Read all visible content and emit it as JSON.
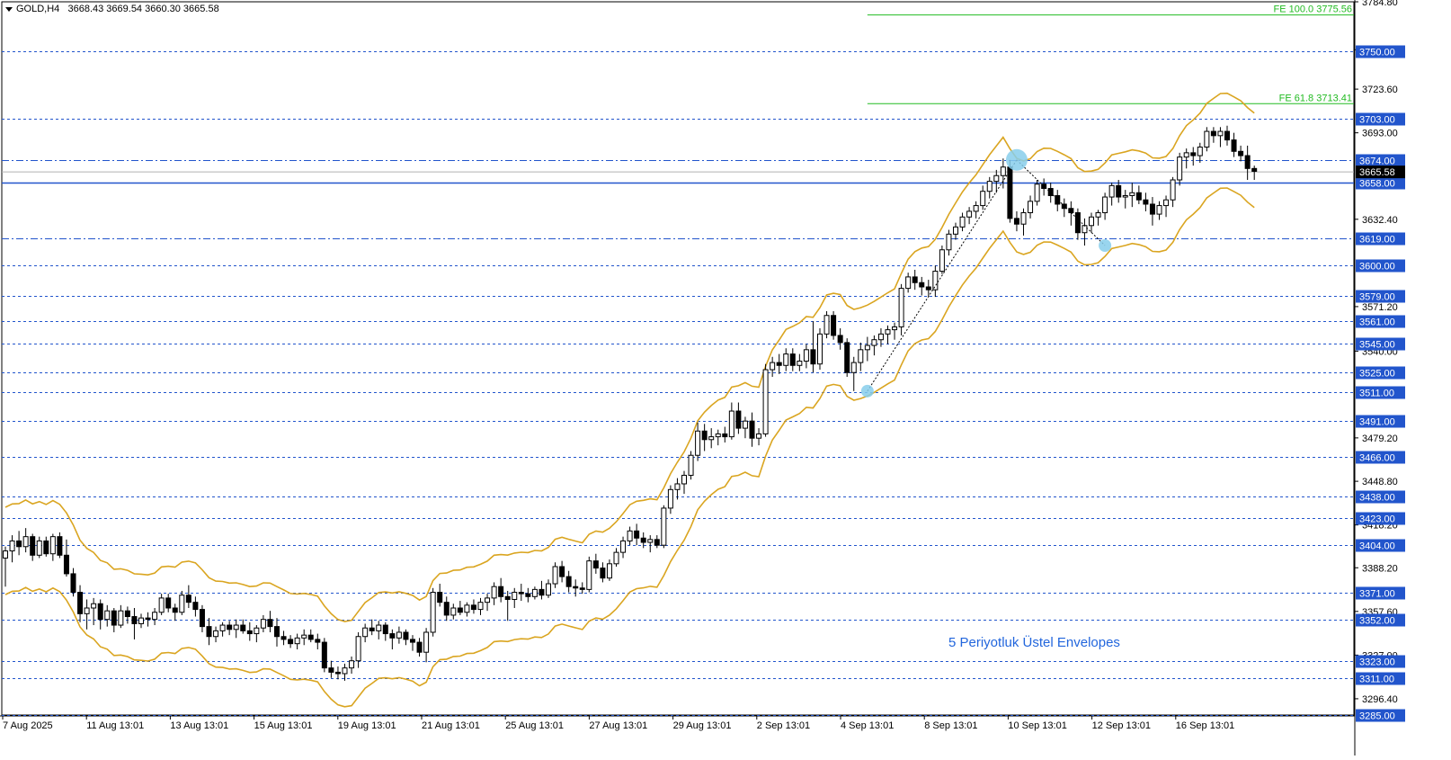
{
  "header": {
    "symbol": "GOLD,H4",
    "ohlc": "3668.43 3669.54 3660.30 3665.58"
  },
  "annotation": "5 Periyotluk Üstel Envelopes",
  "colors": {
    "up_candle": "#ffffff",
    "down_candle": "#000000",
    "envelope": "#daa520",
    "level_line": "#2255cc",
    "fib_line": "#22bb22",
    "label_bg": "#2255cc",
    "price_label_bg": "#000000",
    "marker": "#87ceeb"
  },
  "chart_data": {
    "type": "candlestick",
    "ylim": [
      3285,
      3784.8
    ],
    "current_price": "3665.58",
    "y_tick_labels": [
      "3784.80",
      "3751.20",
      "3723.60",
      "3693.00",
      "3632.40",
      "3571.20",
      "3540.00",
      "3479.20",
      "3448.80",
      "3418.20",
      "3388.20",
      "3357.60",
      "3327.00",
      "3296.40"
    ],
    "x_tick_labels": [
      "7 Aug 2025",
      "11 Aug 13:01",
      "13 Aug 13:01",
      "15 Aug 13:01",
      "19 Aug 13:01",
      "21 Aug 13:01",
      "25 Aug 13:01",
      "27 Aug 13:01",
      "29 Aug 13:01",
      "2 Sep 13:01",
      "4 Sep 13:01",
      "8 Sep 13:01",
      "10 Sep 13:01",
      "12 Sep 13:01",
      "16 Sep 13:01"
    ],
    "levels": [
      {
        "value": 3750.0,
        "label": "3750.00",
        "style": "dashed"
      },
      {
        "value": 3703.0,
        "label": "3703.00",
        "style": "dashed"
      },
      {
        "value": 3674.0,
        "label": "3674.00",
        "style": "dashdot"
      },
      {
        "value": 3658.0,
        "label": "3658.00",
        "style": "solid"
      },
      {
        "value": 3619.0,
        "label": "3619.00",
        "style": "dashdot"
      },
      {
        "value": 3600.0,
        "label": "3600.00",
        "style": "dashed"
      },
      {
        "value": 3579.0,
        "label": "3579.00",
        "style": "dashed"
      },
      {
        "value": 3561.0,
        "label": "3561.00",
        "style": "dashed"
      },
      {
        "value": 3545.0,
        "label": "3545.00",
        "style": "dashed"
      },
      {
        "value": 3525.0,
        "label": "3525.00",
        "style": "dashed"
      },
      {
        "value": 3511.0,
        "label": "3511.00",
        "style": "dashed"
      },
      {
        "value": 3491.0,
        "label": "3491.00",
        "style": "dashed"
      },
      {
        "value": 3466.0,
        "label": "3466.00",
        "style": "dashed"
      },
      {
        "value": 3438.0,
        "label": "3438.00",
        "style": "dashed"
      },
      {
        "value": 3423.0,
        "label": "3423.00",
        "style": "dashed"
      },
      {
        "value": 3404.0,
        "label": "3404.00",
        "style": "dashed"
      },
      {
        "value": 3371.0,
        "label": "3371.00",
        "style": "dashed"
      },
      {
        "value": 3352.0,
        "label": "3352.00",
        "style": "dashed"
      },
      {
        "value": 3323.0,
        "label": "3323.00",
        "style": "dashed"
      },
      {
        "value": 3311.0,
        "label": "3311.00",
        "style": "dashed"
      },
      {
        "value": 3285.0,
        "label": "3285.00",
        "style": "dashed"
      }
    ],
    "fib_lines": [
      {
        "value": 3775.56,
        "label": "FE 100.0 3775.56",
        "start_bar": 127
      },
      {
        "value": 3713.41,
        "label": "FE 61.8 3713.41",
        "start_bar": 127
      }
    ],
    "fib_points": [
      {
        "bar": 127,
        "price": 3512
      },
      {
        "bar": 149,
        "price": 3674
      },
      {
        "bar": 162,
        "price": 3614
      }
    ],
    "envelope_offset_pct": 0.9,
    "candles": [
      [
        3395,
        3403,
        3375,
        3400
      ],
      [
        3400,
        3411,
        3392,
        3407
      ],
      [
        3407,
        3414,
        3397,
        3403
      ],
      [
        3403,
        3416,
        3399,
        3410
      ],
      [
        3410,
        3412,
        3393,
        3397
      ],
      [
        3397,
        3410,
        3395,
        3407
      ],
      [
        3407,
        3410,
        3396,
        3398
      ],
      [
        3398,
        3412,
        3393,
        3410
      ],
      [
        3410,
        3413,
        3395,
        3397
      ],
      [
        3397,
        3408,
        3382,
        3384
      ],
      [
        3384,
        3388,
        3368,
        3371
      ],
      [
        3371,
        3376,
        3350,
        3356
      ],
      [
        3356,
        3366,
        3345,
        3360
      ],
      [
        3360,
        3367,
        3348,
        3363
      ],
      [
        3363,
        3366,
        3345,
        3352
      ],
      [
        3352,
        3362,
        3347,
        3358
      ],
      [
        3358,
        3360,
        3343,
        3348
      ],
      [
        3348,
        3362,
        3346,
        3358
      ],
      [
        3358,
        3361,
        3349,
        3354
      ],
      [
        3354,
        3360,
        3338,
        3349
      ],
      [
        3349,
        3356,
        3346,
        3353
      ],
      [
        3353,
        3357,
        3347,
        3352
      ],
      [
        3352,
        3360,
        3348,
        3357
      ],
      [
        3357,
        3370,
        3355,
        3367
      ],
      [
        3367,
        3370,
        3357,
        3360
      ],
      [
        3360,
        3363,
        3351,
        3357
      ],
      [
        3357,
        3372,
        3355,
        3369
      ],
      [
        3369,
        3376,
        3360,
        3364
      ],
      [
        3364,
        3368,
        3354,
        3359
      ],
      [
        3359,
        3362,
        3343,
        3347
      ],
      [
        3347,
        3353,
        3334,
        3340
      ],
      [
        3340,
        3347,
        3336,
        3344
      ],
      [
        3344,
        3350,
        3340,
        3348
      ],
      [
        3348,
        3351,
        3341,
        3345
      ],
      [
        3345,
        3352,
        3339,
        3348
      ],
      [
        3348,
        3352,
        3342,
        3344
      ],
      [
        3344,
        3350,
        3337,
        3342
      ],
      [
        3342,
        3348,
        3336,
        3346
      ],
      [
        3346,
        3355,
        3343,
        3352
      ],
      [
        3352,
        3358,
        3343,
        3347
      ],
      [
        3347,
        3353,
        3333,
        3340
      ],
      [
        3340,
        3344,
        3334,
        3338
      ],
      [
        3338,
        3341,
        3332,
        3335
      ],
      [
        3335,
        3342,
        3331,
        3339
      ],
      [
        3339,
        3345,
        3334,
        3341
      ],
      [
        3341,
        3345,
        3336,
        3338
      ],
      [
        3338,
        3342,
        3331,
        3336
      ],
      [
        3336,
        3339,
        3315,
        3318
      ],
      [
        3318,
        3323,
        3311,
        3315
      ],
      [
        3315,
        3319,
        3310,
        3314
      ],
      [
        3314,
        3321,
        3309,
        3318
      ],
      [
        3318,
        3326,
        3314,
        3323
      ],
      [
        3323,
        3343,
        3318,
        3340
      ],
      [
        3340,
        3349,
        3336,
        3346
      ],
      [
        3346,
        3352,
        3341,
        3344
      ],
      [
        3344,
        3351,
        3338,
        3348
      ],
      [
        3348,
        3350,
        3337,
        3342
      ],
      [
        3342,
        3345,
        3331,
        3339
      ],
      [
        3339,
        3347,
        3335,
        3343
      ],
      [
        3343,
        3345,
        3334,
        3338
      ],
      [
        3338,
        3341,
        3330,
        3336
      ],
      [
        3336,
        3339,
        3326,
        3329
      ],
      [
        3329,
        3346,
        3322,
        3343
      ],
      [
        3343,
        3374,
        3340,
        3371
      ],
      [
        3371,
        3377,
        3361,
        3364
      ],
      [
        3364,
        3368,
        3351,
        3355
      ],
      [
        3355,
        3363,
        3352,
        3360
      ],
      [
        3360,
        3365,
        3355,
        3357
      ],
      [
        3357,
        3364,
        3354,
        3362
      ],
      [
        3362,
        3366,
        3356,
        3359
      ],
      [
        3359,
        3367,
        3355,
        3364
      ],
      [
        3364,
        3370,
        3358,
        3367
      ],
      [
        3367,
        3378,
        3362,
        3375
      ],
      [
        3375,
        3381,
        3364,
        3368
      ],
      [
        3368,
        3372,
        3351,
        3366
      ],
      [
        3366,
        3374,
        3360,
        3371
      ],
      [
        3371,
        3377,
        3365,
        3370
      ],
      [
        3370,
        3374,
        3364,
        3368
      ],
      [
        3368,
        3375,
        3366,
        3373
      ],
      [
        3373,
        3379,
        3366,
        3369
      ],
      [
        3369,
        3380,
        3367,
        3377
      ],
      [
        3377,
        3392,
        3374,
        3389
      ],
      [
        3389,
        3393,
        3378,
        3382
      ],
      [
        3382,
        3386,
        3371,
        3375
      ],
      [
        3375,
        3380,
        3368,
        3374
      ],
      [
        3374,
        3378,
        3370,
        3373
      ],
      [
        3373,
        3396,
        3371,
        3393
      ],
      [
        3393,
        3398,
        3384,
        3388
      ],
      [
        3388,
        3392,
        3378,
        3381
      ],
      [
        3381,
        3394,
        3379,
        3391
      ],
      [
        3391,
        3402,
        3389,
        3399
      ],
      [
        3399,
        3410,
        3395,
        3407
      ],
      [
        3407,
        3417,
        3404,
        3414
      ],
      [
        3414,
        3419,
        3404,
        3409
      ],
      [
        3409,
        3413,
        3402,
        3406
      ],
      [
        3406,
        3411,
        3399,
        3408
      ],
      [
        3408,
        3411,
        3402,
        3404
      ],
      [
        3404,
        3432,
        3402,
        3430
      ],
      [
        3430,
        3446,
        3426,
        3443
      ],
      [
        3443,
        3451,
        3436,
        3447
      ],
      [
        3447,
        3456,
        3440,
        3453
      ],
      [
        3453,
        3470,
        3450,
        3467
      ],
      [
        3467,
        3490,
        3463,
        3484
      ],
      [
        3484,
        3489,
        3470,
        3478
      ],
      [
        3478,
        3486,
        3472,
        3480
      ],
      [
        3480,
        3485,
        3474,
        3482
      ],
      [
        3482,
        3487,
        3476,
        3480
      ],
      [
        3480,
        3504,
        3478,
        3498
      ],
      [
        3498,
        3504,
        3482,
        3486
      ],
      [
        3486,
        3494,
        3479,
        3491
      ],
      [
        3491,
        3497,
        3473,
        3479
      ],
      [
        3479,
        3486,
        3474,
        3482
      ],
      [
        3482,
        3531,
        3480,
        3527
      ],
      [
        3527,
        3536,
        3522,
        3532
      ],
      [
        3532,
        3538,
        3524,
        3530
      ],
      [
        3530,
        3542,
        3526,
        3538
      ],
      [
        3538,
        3542,
        3526,
        3530
      ],
      [
        3530,
        3538,
        3526,
        3533
      ],
      [
        3533,
        3545,
        3528,
        3541
      ],
      [
        3541,
        3561,
        3525,
        3531
      ],
      [
        3531,
        3556,
        3527,
        3552
      ],
      [
        3552,
        3568,
        3549,
        3565
      ],
      [
        3565,
        3568,
        3548,
        3551
      ],
      [
        3551,
        3556,
        3541,
        3546
      ],
      [
        3546,
        3549,
        3522,
        3525
      ],
      [
        3525,
        3536,
        3512,
        3532
      ],
      [
        3532,
        3546,
        3526,
        3541
      ],
      [
        3541,
        3550,
        3533,
        3544
      ],
      [
        3544,
        3551,
        3537,
        3548
      ],
      [
        3548,
        3556,
        3543,
        3552
      ],
      [
        3552,
        3558,
        3545,
        3555
      ],
      [
        3555,
        3560,
        3548,
        3557
      ],
      [
        3557,
        3587,
        3551,
        3584
      ],
      [
        3584,
        3595,
        3581,
        3592
      ],
      [
        3592,
        3597,
        3583,
        3588
      ],
      [
        3588,
        3592,
        3579,
        3585
      ],
      [
        3585,
        3590,
        3578,
        3583
      ],
      [
        3583,
        3600,
        3578,
        3596
      ],
      [
        3596,
        3614,
        3594,
        3611
      ],
      [
        3611,
        3625,
        3607,
        3622
      ],
      [
        3622,
        3630,
        3618,
        3627
      ],
      [
        3627,
        3637,
        3624,
        3634
      ],
      [
        3634,
        3641,
        3629,
        3638
      ],
      [
        3638,
        3645,
        3633,
        3642
      ],
      [
        3642,
        3656,
        3639,
        3652
      ],
      [
        3652,
        3662,
        3647,
        3659
      ],
      [
        3659,
        3667,
        3651,
        3663
      ],
      [
        3663,
        3675,
        3654,
        3669
      ],
      [
        3669,
        3674,
        3630,
        3633
      ],
      [
        3633,
        3638,
        3624,
        3629
      ],
      [
        3629,
        3640,
        3621,
        3637
      ],
      [
        3637,
        3649,
        3633,
        3645
      ],
      [
        3645,
        3660,
        3642,
        3657
      ],
      [
        3657,
        3661,
        3649,
        3654
      ],
      [
        3654,
        3658,
        3644,
        3649
      ],
      [
        3649,
        3653,
        3638,
        3643
      ],
      [
        3643,
        3647,
        3634,
        3640
      ],
      [
        3640,
        3645,
        3628,
        3637
      ],
      [
        3637,
        3640,
        3618,
        3623
      ],
      [
        3623,
        3633,
        3614,
        3628
      ],
      [
        3628,
        3637,
        3623,
        3634
      ],
      [
        3634,
        3639,
        3628,
        3637
      ],
      [
        3637,
        3651,
        3632,
        3648
      ],
      [
        3648,
        3658,
        3642,
        3656
      ],
      [
        3656,
        3660,
        3644,
        3648
      ],
      [
        3648,
        3653,
        3640,
        3649
      ],
      [
        3649,
        3658,
        3641,
        3651
      ],
      [
        3651,
        3656,
        3643,
        3646
      ],
      [
        3646,
        3651,
        3638,
        3643
      ],
      [
        3643,
        3648,
        3628,
        3636
      ],
      [
        3636,
        3645,
        3632,
        3642
      ],
      [
        3642,
        3649,
        3634,
        3646
      ],
      [
        3646,
        3662,
        3641,
        3660
      ],
      [
        3660,
        3679,
        3656,
        3676
      ],
      [
        3676,
        3682,
        3668,
        3679
      ],
      [
        3679,
        3683,
        3670,
        3677
      ],
      [
        3677,
        3686,
        3672,
        3683
      ],
      [
        3683,
        3697,
        3680,
        3694
      ],
      [
        3694,
        3697,
        3686,
        3691
      ],
      [
        3691,
        3697,
        3683,
        3694
      ],
      [
        3694,
        3698,
        3684,
        3688
      ],
      [
        3688,
        3693,
        3676,
        3680
      ],
      [
        3680,
        3684,
        3673,
        3677
      ],
      [
        3677,
        3684,
        3660,
        3668
      ],
      [
        3668,
        3670,
        3660,
        3666
      ]
    ]
  }
}
